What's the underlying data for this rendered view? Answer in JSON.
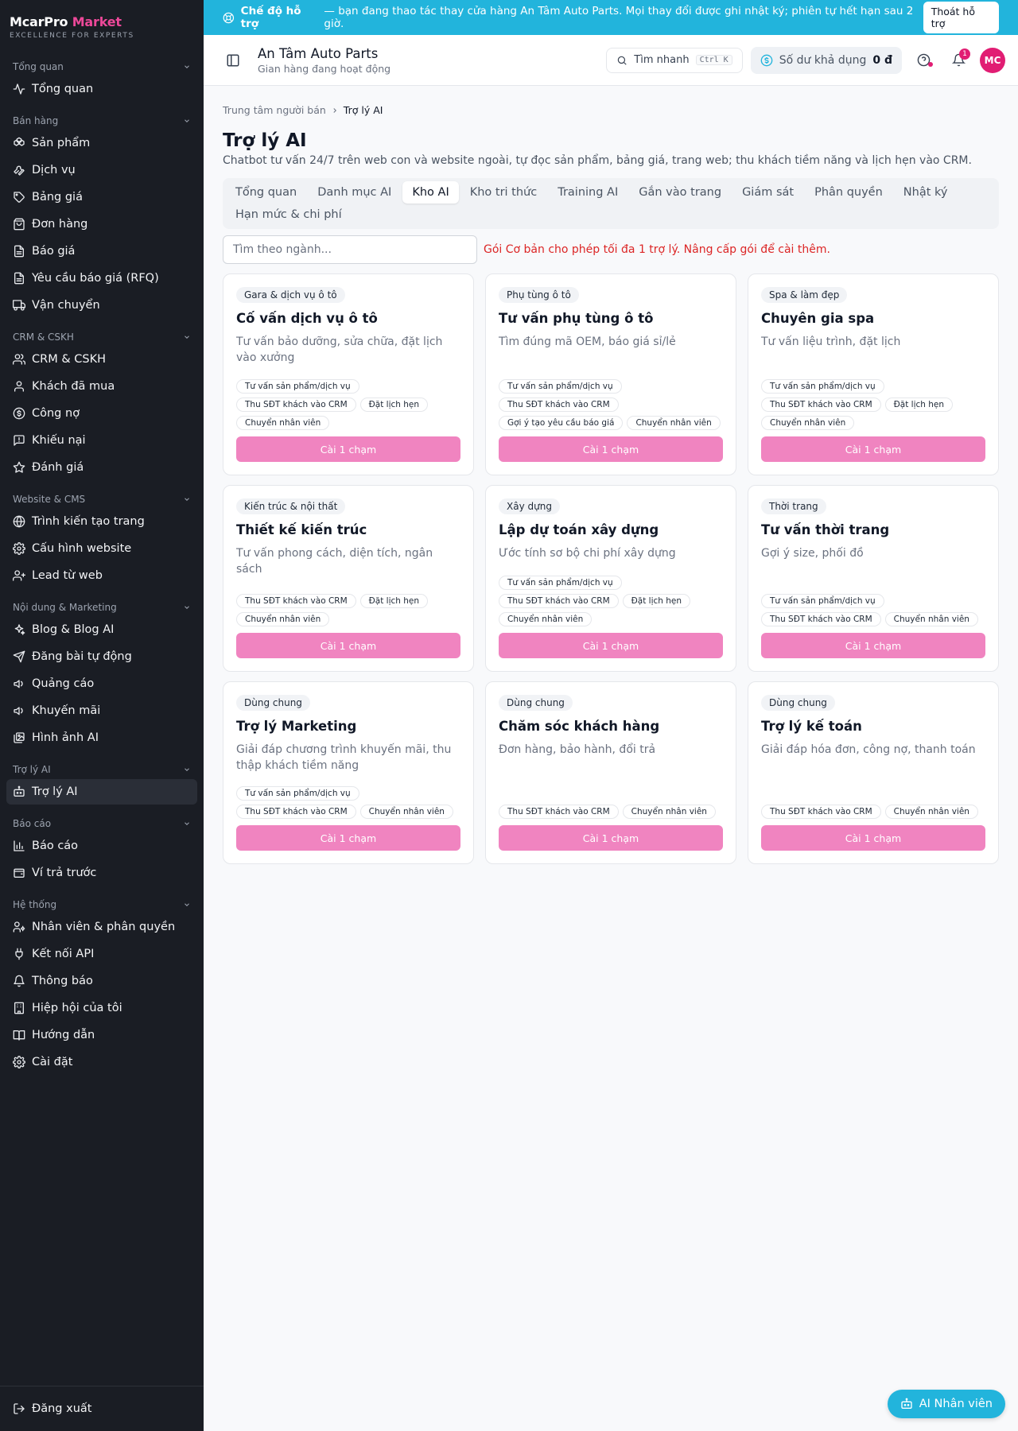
{
  "brand": {
    "name_main": "McarPro",
    "name_accent": "Market",
    "tagline": "EXCELLENCE FOR EXPERTS"
  },
  "sidebar": {
    "groups": [
      {
        "title": "Tổng quan",
        "items": [
          {
            "label": "Tổng quan",
            "icon": "activity-icon"
          }
        ]
      },
      {
        "title": "Bán hàng",
        "items": [
          {
            "label": "Sản phẩm",
            "icon": "boxes-icon"
          },
          {
            "label": "Dịch vụ",
            "icon": "wrench-icon"
          },
          {
            "label": "Bảng giá",
            "icon": "tag-icon"
          },
          {
            "label": "Đơn hàng",
            "icon": "shopping-bag-icon"
          },
          {
            "label": "Báo giá",
            "icon": "file-text-icon"
          },
          {
            "label": "Yêu cầu báo giá (RFQ)",
            "icon": "file-text-icon"
          },
          {
            "label": "Vận chuyển",
            "icon": "truck-icon"
          }
        ]
      },
      {
        "title": "CRM & CSKH",
        "items": [
          {
            "label": "CRM & CSKH",
            "icon": "users-icon"
          },
          {
            "label": "Khách đã mua",
            "icon": "user-icon"
          },
          {
            "label": "Công nợ",
            "icon": "dollar-circle-icon"
          },
          {
            "label": "Khiếu nại",
            "icon": "message-alert-icon"
          },
          {
            "label": "Đánh giá",
            "icon": "star-icon"
          }
        ]
      },
      {
        "title": "Website & CMS",
        "items": [
          {
            "label": "Trình kiến tạo trang",
            "icon": "globe-icon"
          },
          {
            "label": "Cấu hình website",
            "icon": "gear-icon"
          },
          {
            "label": "Lead từ web",
            "icon": "user-plus-icon"
          }
        ]
      },
      {
        "title": "Nội dung & Marketing",
        "items": [
          {
            "label": "Blog & Blog AI",
            "icon": "sparkles-icon"
          },
          {
            "label": "Đăng bài tự động",
            "icon": "send-icon"
          },
          {
            "label": "Quảng cáo",
            "icon": "megaphone-icon"
          },
          {
            "label": "Khuyến mãi",
            "icon": "megaphone-icon"
          },
          {
            "label": "Hình ảnh AI",
            "icon": "images-icon"
          }
        ]
      },
      {
        "title": "Trợ lý AI",
        "items": [
          {
            "label": "Trợ lý AI",
            "icon": "bot-icon",
            "active": true
          }
        ]
      },
      {
        "title": "Báo cáo",
        "items": [
          {
            "label": "Báo cáo",
            "icon": "bar-chart-icon"
          },
          {
            "label": "Ví trả trước",
            "icon": "wallet-icon"
          }
        ]
      },
      {
        "title": "Hệ thống",
        "items": [
          {
            "label": "Nhân viên & phân quyền",
            "icon": "user-cog-icon"
          },
          {
            "label": "Kết nối API",
            "icon": "plug-icon"
          },
          {
            "label": "Thông báo",
            "icon": "bell-icon"
          },
          {
            "label": "Hiệp hội của tôi",
            "icon": "building-icon"
          },
          {
            "label": "Hướng dẫn",
            "icon": "book-icon"
          },
          {
            "label": "Cài đặt",
            "icon": "gear-icon"
          }
        ]
      }
    ],
    "logout": "Đăng xuất"
  },
  "banner": {
    "strong": "Chế độ hỗ trợ",
    "text": "— bạn đang thao tác thay cửa hàng An Tâm Auto Parts. Mọi thay đổi được ghi nhật ký; phiên tự hết hạn sau 2 giờ.",
    "exit_label": "Thoát hỗ trợ"
  },
  "header": {
    "store_name": "An Tâm Auto Parts",
    "store_status": "Gian hàng đang hoạt động",
    "search_label": "Tìm nhanh",
    "search_kbd": "Ctrl K",
    "balance_label": "Số dư khả dụng",
    "balance_value": "0 đ",
    "notif_count": "1",
    "avatar_initials": "MC"
  },
  "main": {
    "breadcrumb": [
      "Trung tâm người bán",
      "Trợ lý AI"
    ],
    "title": "Trợ lý AI",
    "description": "Chatbot tư vấn 24/7 trên web con và website ngoài, tự đọc sản phẩm, bảng giá, trang web; thu khách tiềm năng và lịch hẹn vào CRM.",
    "tabs": [
      "Tổng quan",
      "Danh mục AI",
      "Kho AI",
      "Kho tri thức",
      "Training AI",
      "Gắn vào trang",
      "Giám sát",
      "Phân quyền",
      "Nhật ký",
      "Hạn mức & chi phí"
    ],
    "active_tab": "Kho AI",
    "filter_placeholder": "Tìm theo ngành...",
    "limit_message": "Gói Cơ bản cho phép tối đa 1 trợ lý. Nâng cấp gói để cài thêm.",
    "install_label": "Cài 1 chạm",
    "cards": [
      {
        "category": "Gara & dịch vụ ô tô",
        "title": "Cố vấn dịch vụ ô tô",
        "desc": "Tư vấn bảo dưỡng, sửa chữa, đặt lịch vào xưởng",
        "features": [
          "Tư vấn sản phẩm/dịch vụ",
          "Thu SĐT khách vào CRM",
          "Đặt lịch hẹn",
          "Chuyển nhân viên"
        ]
      },
      {
        "category": "Phụ tùng ô tô",
        "title": "Tư vấn phụ tùng ô tô",
        "desc": "Tìm đúng mã OEM, báo giá sỉ/lẻ",
        "features": [
          "Tư vấn sản phẩm/dịch vụ",
          "Thu SĐT khách vào CRM",
          "Gợi ý tạo yêu cầu báo giá",
          "Chuyển nhân viên"
        ]
      },
      {
        "category": "Spa & làm đẹp",
        "title": "Chuyên gia spa",
        "desc": "Tư vấn liệu trình, đặt lịch",
        "features": [
          "Tư vấn sản phẩm/dịch vụ",
          "Thu SĐT khách vào CRM",
          "Đặt lịch hẹn",
          "Chuyển nhân viên"
        ]
      },
      {
        "category": "Kiến trúc & nội thất",
        "title": "Thiết kế kiến trúc",
        "desc": "Tư vấn phong cách, diện tích, ngân sách",
        "features": [
          "Thu SĐT khách vào CRM",
          "Đặt lịch hẹn",
          "Chuyển nhân viên"
        ]
      },
      {
        "category": "Xây dựng",
        "title": "Lập dự toán xây dựng",
        "desc": "Ước tính sơ bộ chi phí xây dựng",
        "features": [
          "Tư vấn sản phẩm/dịch vụ",
          "Thu SĐT khách vào CRM",
          "Đặt lịch hẹn",
          "Chuyển nhân viên"
        ]
      },
      {
        "category": "Thời trang",
        "title": "Tư vấn thời trang",
        "desc": "Gợi ý size, phối đồ",
        "features": [
          "Tư vấn sản phẩm/dịch vụ",
          "Thu SĐT khách vào CRM",
          "Chuyển nhân viên"
        ]
      },
      {
        "category": "Dùng chung",
        "title": "Trợ lý Marketing",
        "desc": "Giải đáp chương trình khuyến mãi, thu thập khách tiềm năng",
        "features": [
          "Tư vấn sản phẩm/dịch vụ",
          "Thu SĐT khách vào CRM",
          "Chuyển nhân viên"
        ]
      },
      {
        "category": "Dùng chung",
        "title": "Chăm sóc khách hàng",
        "desc": "Đơn hàng, bảo hành, đổi trả",
        "features": [
          "Thu SĐT khách vào CRM",
          "Chuyển nhân viên"
        ]
      },
      {
        "category": "Dùng chung",
        "title": "Trợ lý kế toán",
        "desc": "Giải đáp hóa đơn, công nợ, thanh toán",
        "features": [
          "Thu SĐT khách vào CRM",
          "Chuyển nhân viên"
        ]
      }
    ]
  },
  "fab": {
    "label": "AI Nhân viên"
  },
  "colors": {
    "banner": "#22b4dc",
    "sidebar": "#1a1d24",
    "accent": "#e11d73",
    "install_button": "#f084c0",
    "warning_text": "#dc2626"
  }
}
